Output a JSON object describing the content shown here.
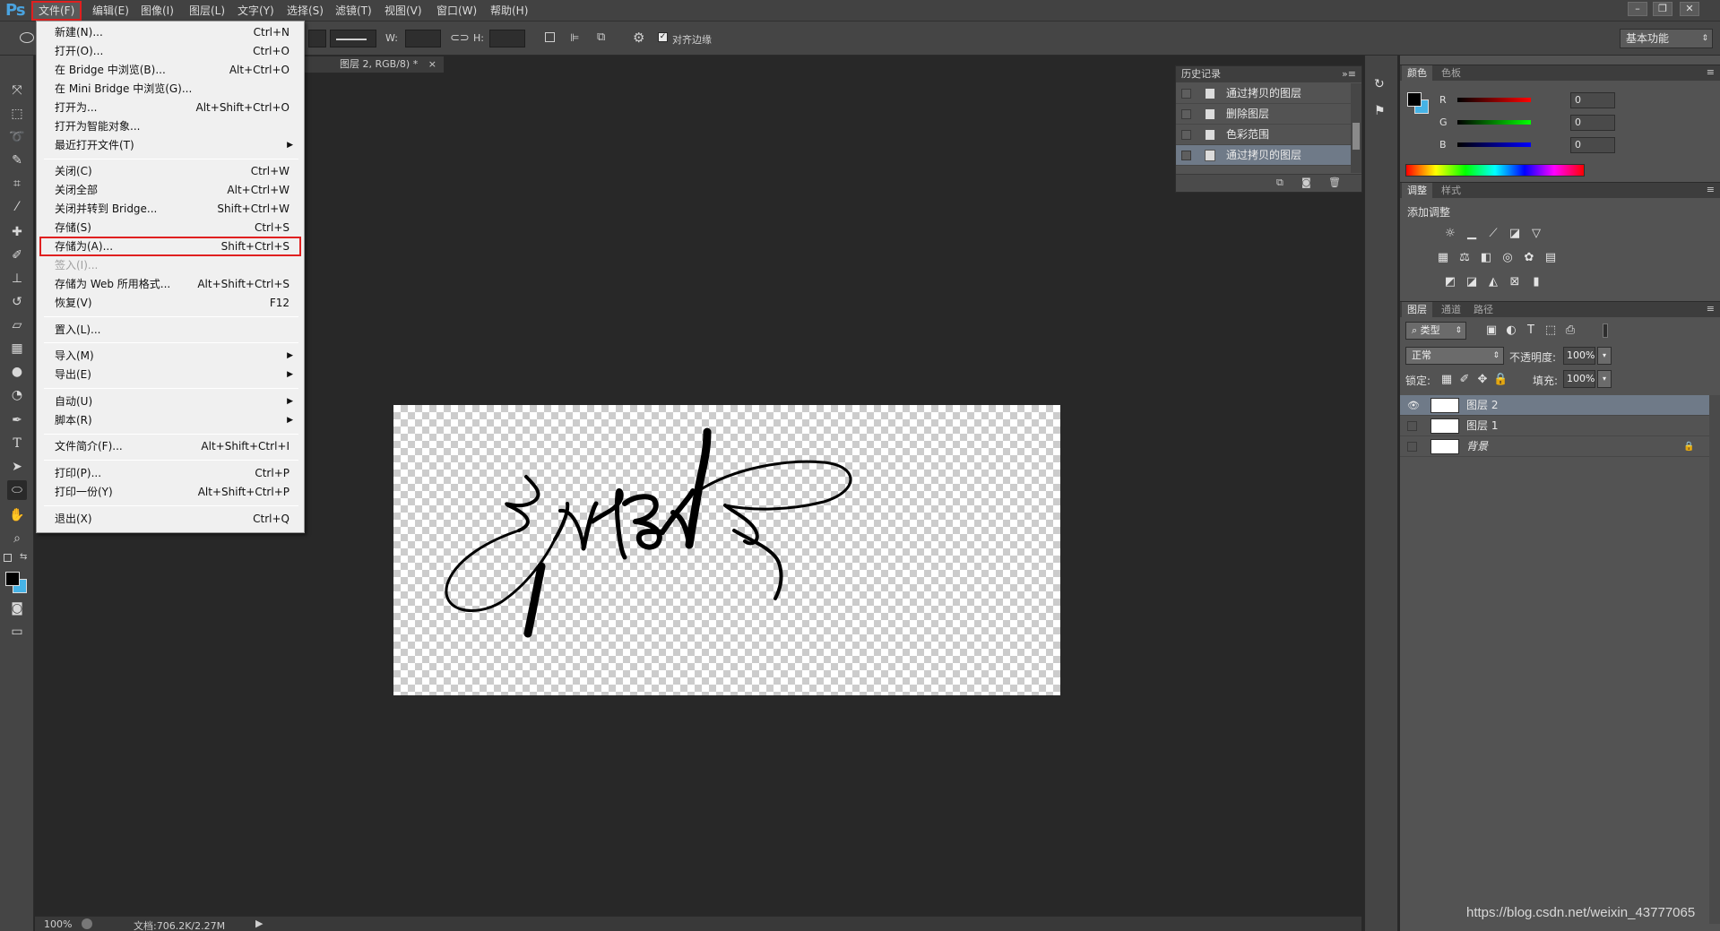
{
  "app": {
    "logo": "Ps",
    "menus": [
      "文件(F)",
      "编辑(E)",
      "图像(I)",
      "图层(L)",
      "文字(Y)",
      "选择(S)",
      "滤镜(T)",
      "视图(V)",
      "窗口(W)",
      "帮助(H)"
    ],
    "window_buttons": {
      "minimize": "–",
      "maximize": "❐",
      "close": "✕"
    }
  },
  "options": {
    "w_label": "W:",
    "h_label": "H:",
    "align_edges": "对齐边缘",
    "workspace": "基本功能"
  },
  "document": {
    "tab_title": "图层 2, RGB/8) *",
    "tab_close": "×",
    "zoom": "100%",
    "doc_info": "文档:706.2K/2.27M"
  },
  "file_menu": {
    "items": [
      {
        "label": "新建(N)...",
        "shortcut": "Ctrl+N"
      },
      {
        "label": "打开(O)...",
        "shortcut": "Ctrl+O"
      },
      {
        "label": "在 Bridge 中浏览(B)...",
        "shortcut": "Alt+Ctrl+O"
      },
      {
        "label": "在 Mini Bridge 中浏览(G)...",
        "shortcut": ""
      },
      {
        "label": "打开为...",
        "shortcut": "Alt+Shift+Ctrl+O"
      },
      {
        "label": "打开为智能对象...",
        "shortcut": ""
      },
      {
        "label": "最近打开文件(T)",
        "shortcut": ""
      },
      {
        "label": "关闭(C)",
        "shortcut": "Ctrl+W"
      },
      {
        "label": "关闭全部",
        "shortcut": "Alt+Ctrl+W"
      },
      {
        "label": "关闭并转到 Bridge...",
        "shortcut": "Shift+Ctrl+W"
      },
      {
        "label": "存储(S)",
        "shortcut": "Ctrl+S"
      },
      {
        "label": "存储为(A)...",
        "shortcut": "Shift+Ctrl+S"
      },
      {
        "label": "签入(I)...",
        "shortcut": ""
      },
      {
        "label": "存储为 Web 所用格式...",
        "shortcut": "Alt+Shift+Ctrl+S"
      },
      {
        "label": "恢复(V)",
        "shortcut": "F12"
      },
      {
        "label": "置入(L)...",
        "shortcut": ""
      },
      {
        "label": "导入(M)",
        "shortcut": ""
      },
      {
        "label": "导出(E)",
        "shortcut": ""
      },
      {
        "label": "自动(U)",
        "shortcut": ""
      },
      {
        "label": "脚本(R)",
        "shortcut": ""
      },
      {
        "label": "文件简介(F)...",
        "shortcut": "Alt+Shift+Ctrl+I"
      },
      {
        "label": "打印(P)...",
        "shortcut": "Ctrl+P"
      },
      {
        "label": "打印一份(Y)",
        "shortcut": "Alt+Shift+Ctrl+P"
      },
      {
        "label": "退出(X)",
        "shortcut": "Ctrl+Q"
      }
    ]
  },
  "history": {
    "title": "历史记录",
    "items": [
      "通过拷贝的图层",
      "删除图层",
      "色彩范围",
      "通过拷贝的图层"
    ]
  },
  "color_panel": {
    "tabs": [
      "颜色",
      "色板"
    ],
    "channels": [
      {
        "name": "R",
        "value": "0"
      },
      {
        "name": "G",
        "value": "0"
      },
      {
        "name": "B",
        "value": "0"
      }
    ]
  },
  "adjust_panel": {
    "tabs": [
      "调整",
      "样式"
    ],
    "title": "添加调整"
  },
  "layers_panel": {
    "tabs": [
      "图层",
      "通道",
      "路径"
    ],
    "filter": "类型",
    "blend_mode": "正常",
    "opacity_label": "不透明度:",
    "opacity": "100%",
    "lock_label": "锁定:",
    "fill_label": "填充:",
    "fill": "100%",
    "layers": [
      {
        "name": "图层 2",
        "visible": true,
        "selected": true
      },
      {
        "name": "图层 1",
        "visible": false,
        "selected": false
      },
      {
        "name": "背景",
        "visible": false,
        "selected": false,
        "locked": true
      }
    ]
  },
  "watermark": "https://blog.csdn.net/weixin_43777065",
  "colors": {
    "accent_highlight": "#e02020",
    "selection": "#6f7a88",
    "swatch_bg": "#46b3e6"
  }
}
